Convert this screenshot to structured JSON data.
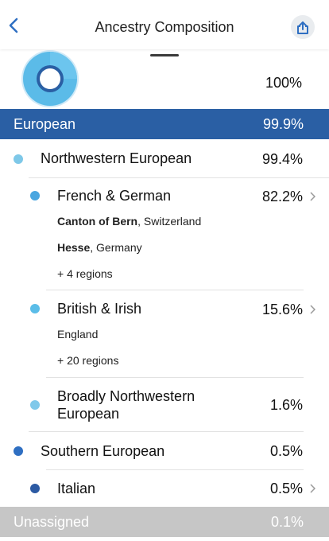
{
  "header": {
    "title": "Ancestry Composition"
  },
  "summary": {
    "total": "100%"
  },
  "composition": {
    "european": {
      "label": "European",
      "percent": "99.9%",
      "color": "#2a5fa4"
    },
    "northwestern": {
      "label": "Northwestern European",
      "percent": "99.4%",
      "color": "#7ec8e8"
    },
    "french_german": {
      "label": "French & German",
      "percent": "82.2%",
      "color": "#4aa6e0",
      "regions": [
        {
          "name": "Canton of Bern",
          "country": ", Switzerland"
        },
        {
          "name": "Hesse",
          "country": ", Germany"
        }
      ],
      "more": "+ 4 regions"
    },
    "british_irish": {
      "label": "British & Irish",
      "percent": "15.6%",
      "color": "#5bbde8",
      "region": "England",
      "more": "+ 20 regions"
    },
    "broad_nw": {
      "label_line1": "Broadly Northwestern",
      "label_line2": "European",
      "percent": "1.6%",
      "color": "#80c9ea"
    },
    "southern": {
      "label": "Southern European",
      "percent": "0.5%",
      "color": "#2f6fc2"
    },
    "italian": {
      "label": "Italian",
      "percent": "0.5%",
      "color": "#2c5aa3"
    },
    "unassigned": {
      "label": "Unassigned",
      "percent": "0.1%",
      "color": "#c6c6c6"
    }
  }
}
